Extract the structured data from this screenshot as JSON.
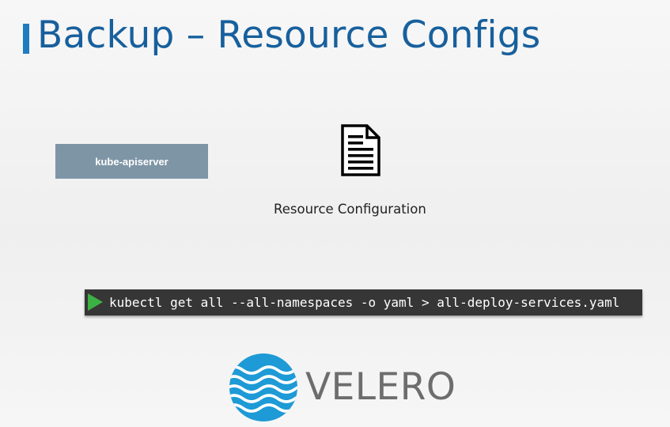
{
  "slide": {
    "title": "Backup – Resource Configs",
    "accent_color": "#1f7cc0",
    "title_color": "#17609d"
  },
  "apiserver": {
    "label": "kube-apiserver",
    "color": "#7e95a6"
  },
  "resource_config": {
    "icon": "document-icon",
    "label": "Resource Configuration"
  },
  "terminal": {
    "prompt_icon": "play-icon",
    "prompt_color": "#3cb043",
    "command": "kubectl get all --all-namespaces -o yaml > all-deploy-services.yaml"
  },
  "velero": {
    "icon": "velero-waves-icon",
    "logo_color": "#1e9ad6",
    "label": "VELERO"
  }
}
